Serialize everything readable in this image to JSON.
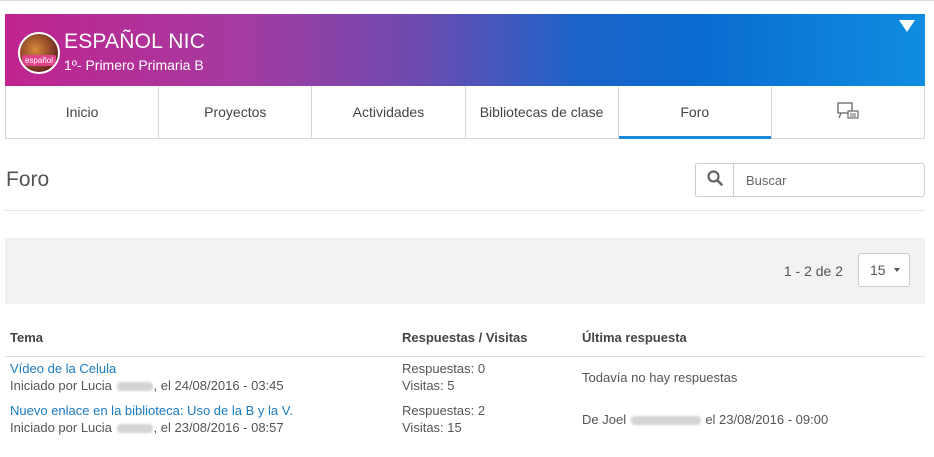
{
  "banner": {
    "title": "ESPAÑOL NIC",
    "subtitle": "1º- Primero Primaria B",
    "avatar_tag": "español",
    "gradient_start": "#c0248f",
    "gradient_end": "#0f8de0"
  },
  "tabs": [
    {
      "label": "Inicio"
    },
    {
      "label": "Proyectos"
    },
    {
      "label": "Actividades"
    },
    {
      "label": "Bibliotecas de clase"
    },
    {
      "label": "Foro",
      "active": true
    },
    {
      "label": "",
      "icon": "classroom-icon"
    }
  ],
  "page": {
    "title": "Foro"
  },
  "search": {
    "placeholder": "Buscar",
    "icon": "search-icon"
  },
  "pager": {
    "count": "1 - 2 de 2",
    "page_size": "15"
  },
  "table": {
    "headers": [
      "Tema",
      "Respuestas / Visitas",
      "Última respuesta"
    ],
    "rows": [
      {
        "title": "Vídeo de la Celula",
        "started_prefix": "Iniciado por Lucia",
        "started_suffix": ", el 24/08/2016 - 03:45",
        "replies": "Respuestas: 0",
        "visits": "Visitas: 5",
        "last_reply": "Todavía no hay respuestas"
      },
      {
        "title": "Nuevo enlace en la biblioteca: Uso de la B y la V.",
        "started_prefix": "Iniciado por Lucia",
        "started_suffix": ", el 23/08/2016 - 08:57",
        "replies": "Respuestas: 2",
        "visits": "Visitas: 15",
        "last_reply_prefix": "De Joel",
        "last_reply_suffix": "el 23/08/2016 - 09:00"
      }
    ]
  },
  "colors": {
    "accent": "#1a8ad8",
    "link": "#1a7bc1"
  }
}
